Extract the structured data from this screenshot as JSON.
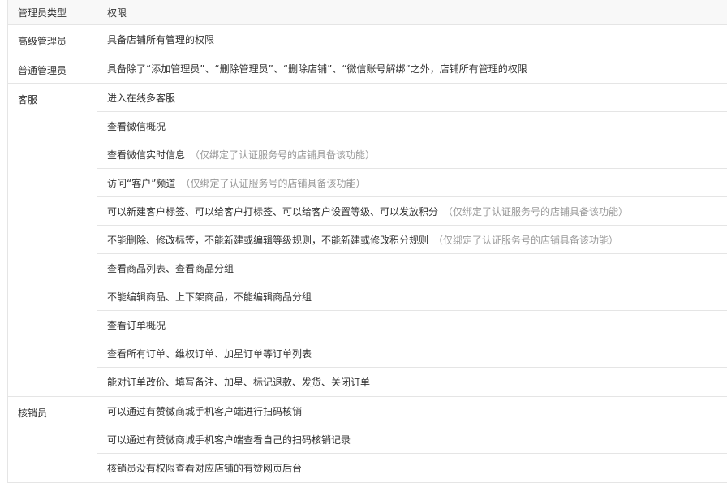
{
  "header": {
    "type_label": "管理员类型",
    "perm_label": "权限"
  },
  "rows": [
    {
      "type": "高级管理员",
      "perms": [
        {
          "text": "具备店铺所有管理的权限",
          "note": ""
        }
      ]
    },
    {
      "type": "普通管理员",
      "perms": [
        {
          "text": "具备除了“添加管理员”、“删除管理员”、“删除店铺”、“微信账号解绑”之外，店铺所有管理的权限",
          "note": ""
        }
      ]
    },
    {
      "type": "客服",
      "perms": [
        {
          "text": "进入在线多客服",
          "note": ""
        },
        {
          "text": "查看微信概况",
          "note": ""
        },
        {
          "text": "查看微信实时信息",
          "note": "（仅绑定了认证服务号的店铺具备该功能）"
        },
        {
          "text": "访问“客户”频道",
          "note": "（仅绑定了认证服务号的店铺具备该功能）"
        },
        {
          "text": "可以新建客户标签、可以给客户打标签、可以给客户设置等级、可以发放积分",
          "note": "（仅绑定了认证服务号的店铺具备该功能）"
        },
        {
          "text": "不能删除、修改标签，不能新建或编辑等级规则，不能新建或修改积分规则",
          "note": "（仅绑定了认证服务号的店铺具备该功能）"
        },
        {
          "text": "查看商品列表、查看商品分组",
          "note": ""
        },
        {
          "text": "不能编辑商品、上下架商品，不能编辑商品分组",
          "note": ""
        },
        {
          "text": "查看订单概况",
          "note": ""
        },
        {
          "text": "查看所有订单、维权订单、加星订单等订单列表",
          "note": ""
        },
        {
          "text": "能对订单改价、填写备注、加星、标记退款、发货、关闭订单",
          "note": ""
        }
      ]
    },
    {
      "type": "核销员",
      "perms": [
        {
          "text": "可以通过有赞微商城手机客户端进行扫码核销",
          "note": ""
        },
        {
          "text": "可以通过有赞微商城手机客户端查看自己的扫码核销记录",
          "note": ""
        },
        {
          "text": "核销员没有权限查看对应店铺的有赞网页后台",
          "note": ""
        }
      ]
    }
  ]
}
